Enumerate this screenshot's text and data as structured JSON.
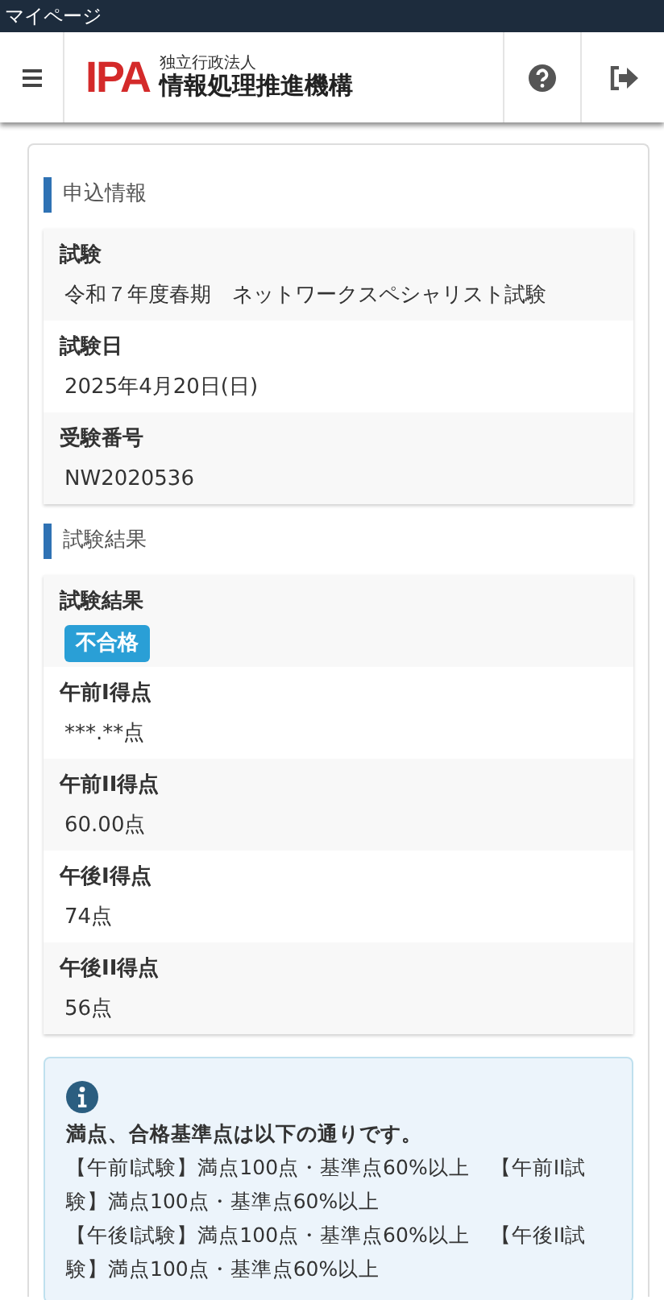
{
  "status_bar": {
    "title": "マイページ"
  },
  "header": {
    "logo_mark": "IPA",
    "logo_sub": "独立行政法人",
    "logo_name": "情報処理推進機構"
  },
  "sections": [
    {
      "title": "申込情報",
      "rows": [
        {
          "kind": "text",
          "label": "試験",
          "value": "令和７年度春期　ネットワークスペシャリスト試験"
        },
        {
          "kind": "text",
          "label": "試験日",
          "value": "2025年4月20日(日)"
        },
        {
          "kind": "text",
          "label": "受験番号",
          "value": "NW2020536"
        }
      ]
    },
    {
      "title": "試験結果",
      "rows": [
        {
          "kind": "badge",
          "label": "試験結果",
          "value": "不合格"
        },
        {
          "kind": "text",
          "label": "午前I得点",
          "value": "***.**点"
        },
        {
          "kind": "text",
          "label": "午前II得点",
          "value": "60.00点"
        },
        {
          "kind": "text",
          "label": "午後I得点",
          "value": "74点"
        },
        {
          "kind": "text",
          "label": "午後II得点",
          "value": "56点"
        }
      ]
    }
  ],
  "info": {
    "heading": "満点、合格基準点は以下の通りです。",
    "lines": [
      "【午前I試験】満点100点・基準点60%以上　【午前II試験】満点100点・基準点60%以上",
      "【午後I試験】満点100点・基準点60%以上　【午後II試験】満点100点・基準点60%以上"
    ]
  }
}
